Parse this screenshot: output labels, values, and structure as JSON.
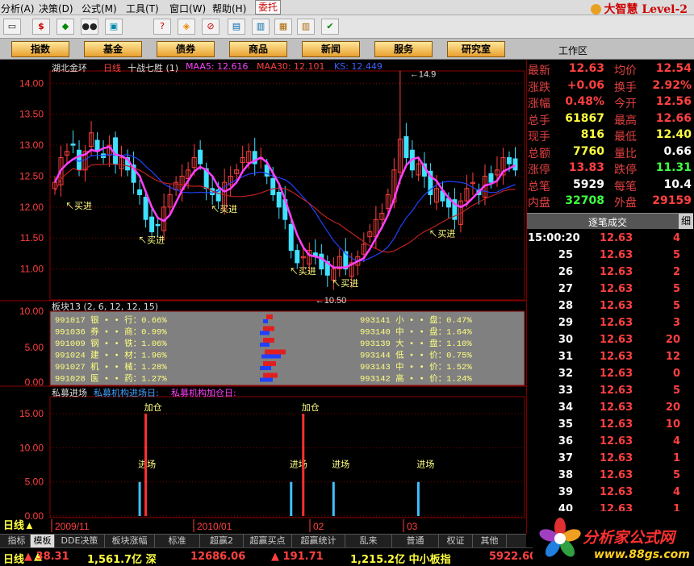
{
  "menu": {
    "items": [
      "分析(A)",
      "决策(D)",
      "公式(M)",
      "工具(T)",
      "窗口(W)",
      "帮助(H)",
      "委托"
    ],
    "brand": "大智慧 Level-2"
  },
  "toolbar": {
    "icons": [
      "ruler-icon",
      "dollar-icon",
      "flag-icon",
      "binoculars-icon",
      "gift-icon",
      "diamond-icon",
      "no-icon",
      "disk-icon",
      "window-icon",
      "books-icon",
      "check-icon"
    ]
  },
  "nav": {
    "buttons": [
      "指数",
      "基金",
      "债券",
      "商品",
      "新闻",
      "服务",
      "研究室"
    ],
    "workarea": "工作区"
  },
  "chart": {
    "stock_name": "湖北金环",
    "period": "日线",
    "formula": "十战七胜 (1)",
    "ma5": "MAA5: 12.616",
    "ma30": "MAA30: 12.101",
    "ks": "KS: 12.449",
    "high_label": "14.90",
    "low_label": "10.50",
    "buy_label": "买进",
    "block_title": "板块13 (2, 6, 12, 12, 15)",
    "private_title": "私募进场",
    "private_in": "私募机构进场日:",
    "private_add": "私募机构加仓日:",
    "add_label": "加仓",
    "enter_label": "进场",
    "date_labels": [
      "2009/11",
      "2010/01",
      "02",
      "03"
    ],
    "colors": {
      "up": "#ff4040",
      "down": "#40e0ff",
      "ma5": "#ff40ff",
      "ma30": "#2040ff",
      "ks": "#c02020",
      "grid": "#8b0000"
    }
  },
  "chart_data": [
    {
      "type": "candlestick",
      "title": "湖北金环 日线",
      "ylim": [
        10.5,
        14.2
      ],
      "yticks": [
        "14.00",
        "13.50",
        "13.00",
        "12.50",
        "12.00",
        "11.50",
        "11.00"
      ],
      "high": 14.9,
      "low": 10.5,
      "closes": [
        12.4,
        12.8,
        12.9,
        13.0,
        12.6,
        12.9,
        13.2,
        12.9,
        12.8,
        13.0,
        12.7,
        12.8,
        12.6,
        12.4,
        12.2,
        11.8,
        11.6,
        11.7,
        12.0,
        12.2,
        12.4,
        12.5,
        12.6,
        12.8,
        12.7,
        12.3,
        12.2,
        12.1,
        12.4,
        12.5,
        12.6,
        12.8,
        12.9,
        12.7,
        12.8,
        12.5,
        12.2,
        12.0,
        11.8,
        11.3,
        11.1,
        11.2,
        11.3,
        11.2,
        11.0,
        10.9,
        11.0,
        11.2,
        11.0,
        11.1,
        11.2,
        11.4,
        11.6,
        11.8,
        11.9,
        12.2,
        12.6,
        13.1,
        12.8,
        12.6,
        12.7,
        12.5,
        12.2,
        12.3,
        12.1,
        12.0,
        11.8,
        12.1,
        12.3,
        12.4,
        12.2,
        12.5,
        12.4,
        12.6,
        12.8,
        12.7,
        12.6
      ]
    },
    {
      "type": "table",
      "title": "板块13 (2, 6, 12, 12, 15)",
      "yticks": [
        "10.00",
        "5.00",
        "0.00"
      ],
      "rows": [
        {
          "code": "991017",
          "name": "银 • • 行",
          "pct": "0.66%"
        },
        {
          "code": "991036",
          "name": "券 • • 商",
          "pct": "0.99%"
        },
        {
          "code": "991009",
          "name": "钢 • • 铁",
          "pct": "1.06%"
        },
        {
          "code": "991024",
          "name": "建 • • 材",
          "pct": "1.96%"
        },
        {
          "code": "991027",
          "name": "机 • • 械",
          "pct": "1.28%"
        },
        {
          "code": "991028",
          "name": "医 • • 药",
          "pct": "1.27%"
        },
        {
          "code": "993141",
          "name": "小 • • 盘",
          "pct": "0.47%"
        },
        {
          "code": "993140",
          "name": "中 • • 盘",
          "pct": "1.64%"
        },
        {
          "code": "993139",
          "name": "大 • • 盘",
          "pct": "1.10%"
        },
        {
          "code": "993144",
          "name": "低 • • 价",
          "pct": "0.75%"
        },
        {
          "code": "993143",
          "name": "中 • • 价",
          "pct": "1.52%"
        },
        {
          "code": "993142",
          "name": "高 • • 价",
          "pct": "1.24%"
        }
      ]
    },
    {
      "type": "bar",
      "title": "私募进场",
      "ylim": [
        0,
        17.5
      ],
      "yticks": [
        "15.00",
        "10.00",
        "5.00",
        "0.00"
      ],
      "series": [
        {
          "name": "私募机构进场日",
          "values": [
            5,
            5,
            5,
            5
          ]
        },
        {
          "name": "私募机构加仓日",
          "values": [
            15,
            15
          ]
        }
      ]
    }
  ],
  "quote": [
    {
      "l": "最新",
      "v": "12.63",
      "vc": "#ff4040",
      "l2": "均价",
      "v2": "12.54",
      "v2c": "#ff4040"
    },
    {
      "l": "涨跌",
      "v": "+0.06",
      "vc": "#ff4040",
      "l2": "换手",
      "v2": "2.92%",
      "v2c": "#ff4040"
    },
    {
      "l": "涨幅",
      "v": "0.48%",
      "vc": "#ff4040",
      "l2": "今开",
      "v2": "12.56",
      "v2c": "#ff4040"
    },
    {
      "l": "总手",
      "v": "61867",
      "vc": "#ffff40",
      "l2": "最高",
      "v2": "12.66",
      "v2c": "#ff4040"
    },
    {
      "l": "现手",
      "v": "816",
      "vc": "#ffff40",
      "l2": "最低",
      "v2": "12.40",
      "v2c": "#ffff40"
    },
    {
      "l": "总额",
      "v": "7760",
      "vc": "#ffff40",
      "l2": "量比",
      "v2": "0.66",
      "v2c": "#ffffff"
    },
    {
      "l": "涨停",
      "v": "13.83",
      "vc": "#ff4040",
      "l2": "跌停",
      "v2": "11.31",
      "v2c": "#40ff40"
    },
    {
      "l": "总笔",
      "v": "5929",
      "vc": "#ffffff",
      "l2": "每笔",
      "v2": "10.4",
      "v2c": "#ffffff"
    },
    {
      "l": "内盘",
      "v": "32708",
      "vc": "#40ff40",
      "l2": "外盘",
      "v2": "29159",
      "v2c": "#ff4040"
    }
  ],
  "ticks": {
    "header": "逐笔成交",
    "tab": "细",
    "rows": [
      [
        "15:00:20",
        "12.63",
        "4"
      ],
      [
        "25",
        "12.63",
        "5"
      ],
      [
        "26",
        "12.63",
        "2"
      ],
      [
        "27",
        "12.63",
        "5"
      ],
      [
        "28",
        "12.63",
        "5"
      ],
      [
        "29",
        "12.63",
        "3"
      ],
      [
        "30",
        "12.63",
        "20"
      ],
      [
        "31",
        "12.63",
        "12"
      ],
      [
        "32",
        "12.63",
        "0"
      ],
      [
        "33",
        "12.63",
        "5"
      ],
      [
        "34",
        "12.63",
        "20"
      ],
      [
        "35",
        "12.63",
        "10"
      ],
      [
        "36",
        "12.63",
        "4"
      ],
      [
        "37",
        "12.63",
        "1"
      ],
      [
        "38",
        "12.63",
        "5"
      ],
      [
        "39",
        "12.63",
        "4"
      ],
      [
        "40",
        "12.63",
        "1"
      ]
    ]
  },
  "tabs": [
    "指标",
    "模板",
    "DDE决策",
    "板块涨幅",
    "标准",
    "超赢2",
    "超赢买点",
    "超赢统计",
    "乱来",
    "普通",
    "权证",
    "其他"
  ],
  "status": {
    "period": "日线",
    "s1": "▲ 38.31",
    "s2": "1,561.7亿 深",
    "s3": "12686.06",
    "s4": "▲ 191.71",
    "s5": "1,215.2亿 中小板指",
    "s6": "5922.60"
  },
  "logo": {
    "text": "分析家公式网",
    "url": "www.88gs.com"
  }
}
